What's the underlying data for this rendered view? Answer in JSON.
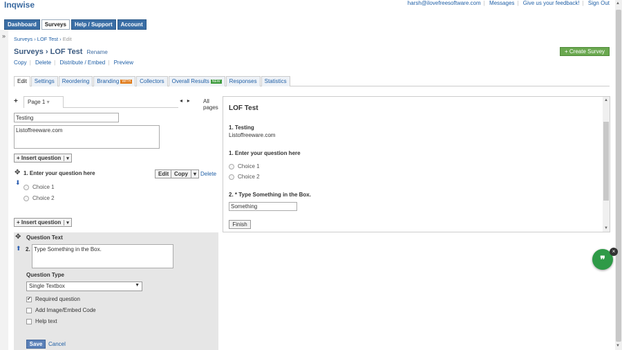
{
  "app": {
    "logo": "Inqwise",
    "top_links": [
      "harsh@ilovefreesoftware.com",
      "Messages",
      "Give us your feedback!",
      "Sign Out"
    ]
  },
  "nav": [
    "Dashboard",
    "Surveys",
    "Help / Support",
    "Account"
  ],
  "nav_active": "Surveys",
  "breadcrumb": {
    "root": "Surveys",
    "sep1": "›",
    "item": "LOF Test",
    "sep2": "›",
    "current": "Edit"
  },
  "title": {
    "prefix": "Surveys",
    "arrow": "›",
    "name": "LOF Test",
    "rename": "Rename"
  },
  "actions": [
    "Copy",
    "Delete",
    "Distribute / Embed",
    "Preview"
  ],
  "create_survey": "+ Create Survey",
  "subtabs": [
    {
      "label": "Edit",
      "badge": ""
    },
    {
      "label": "Settings",
      "badge": ""
    },
    {
      "label": "Reordering",
      "badge": ""
    },
    {
      "label": "Branding",
      "badge": "WITH"
    },
    {
      "label": "Collectors",
      "badge": ""
    },
    {
      "label": "Overall Results",
      "badge": "NEW"
    },
    {
      "label": "Responses",
      "badge": ""
    },
    {
      "label": "Statistics",
      "badge": ""
    }
  ],
  "badge_colors": {
    "WITH": "#e07b1a",
    "NEW": "#3c9a3c"
  },
  "editor": {
    "add_page_icon": "+",
    "page_tab": "Page 1",
    "page_tab_arrow": "▾",
    "prev_page": "◂",
    "next_page": "▸",
    "all_pages": "All pages",
    "page_title_value": "Testing",
    "page_desc_value": "Listoffreeware.com",
    "insert_question": "+ Insert question",
    "dropdown_glyph": "▾",
    "question1": {
      "label": "1. Enter your question here",
      "choices": [
        "Choice 1",
        "Choice 2"
      ],
      "edit": "Edit",
      "copy": "Copy",
      "delete": "Delete"
    },
    "question2_panel": {
      "question_text_label": "Question Text",
      "number": "2.",
      "question_text_value": "Type Something in the Box.",
      "question_type_label": "Question Type",
      "question_type_value": "Single Textbox",
      "checkboxes": [
        {
          "label": "Required question",
          "checked": true
        },
        {
          "label": "Add Image/Embed Code",
          "checked": false
        },
        {
          "label": "Help text",
          "checked": false
        }
      ],
      "save": "Save",
      "cancel": "Cancel"
    }
  },
  "preview": {
    "title": "LOF Test",
    "q1_title": "1. Testing",
    "q1_sub": "Listoffreeware.com",
    "q2_title": "1. Enter your question here",
    "q2_choices": [
      "Choice 1",
      "Choice 2"
    ],
    "q3_title": "2. * Type Something in the Box.",
    "q3_value": "Something",
    "finish": "Finish"
  },
  "collapse_glyph": "»",
  "chat_glyph": "❞",
  "chat_close": "×"
}
